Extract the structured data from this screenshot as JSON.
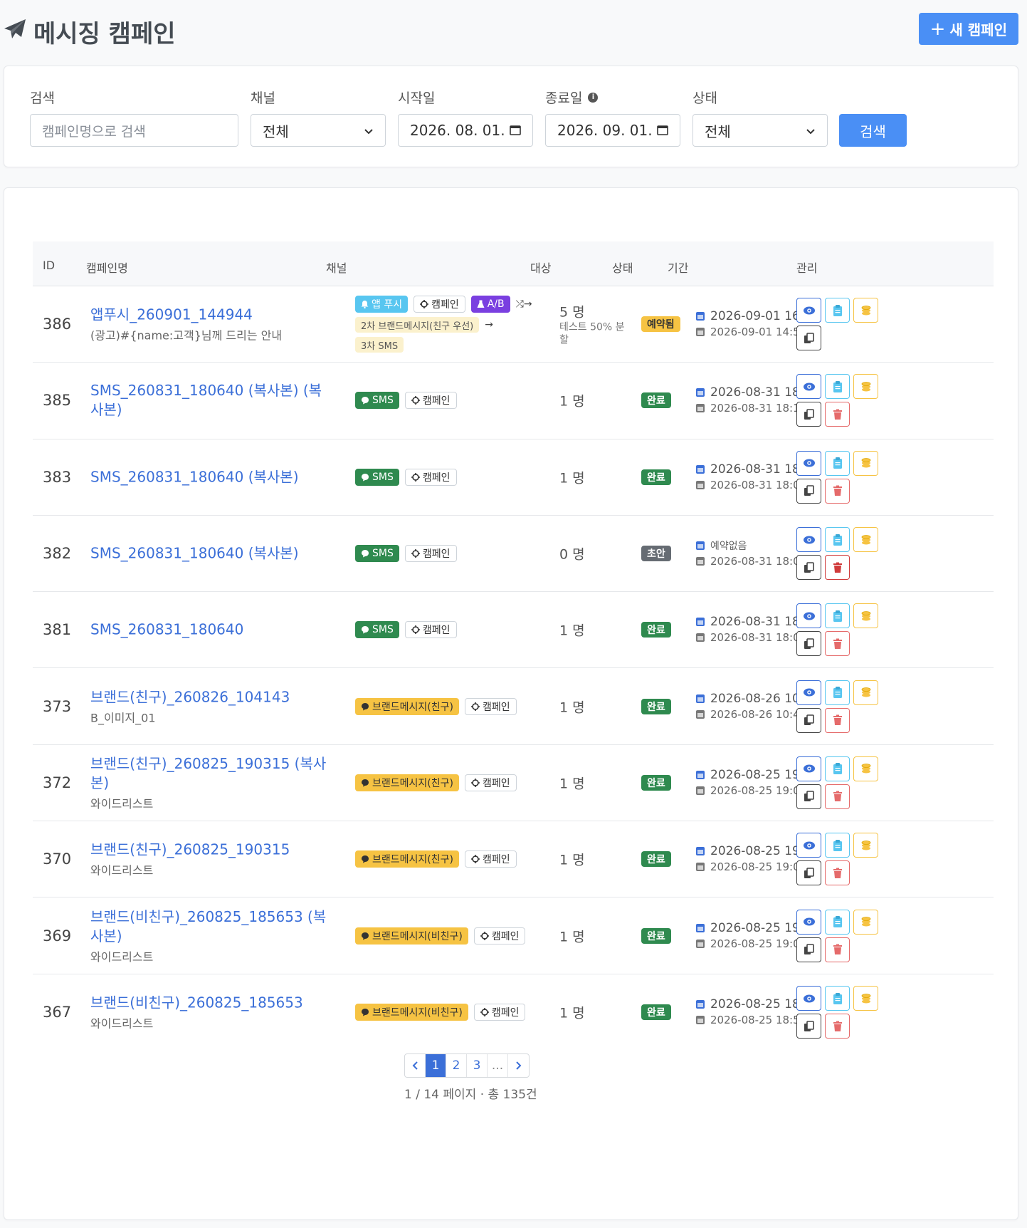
{
  "header": {
    "title": "메시징 캠페인",
    "title_icon": "paper-plane-icon",
    "new_button_label": "새 캠페인",
    "new_button_icon": "plus-icon"
  },
  "filters": {
    "search_label": "검색",
    "search_placeholder": "캠페인명으로 검색",
    "channel_label": "채널",
    "channel_value": "전체",
    "start_label": "시작일",
    "start_value": "2026. 08. 01.",
    "end_label": "종료일",
    "end_value": "2026. 09. 01.",
    "status_label": "상태",
    "status_value": "전체",
    "search_button": "검색"
  },
  "table": {
    "headers": [
      "ID",
      "캠페인명",
      "채널",
      "대상",
      "상태",
      "기간",
      "관리"
    ],
    "rows": [
      {
        "id": "386",
        "name": "앱푸시_260901_144944",
        "sub": "(광고)#{name:고객}님께 드리는 안내",
        "target": "5 명",
        "target_sub": "테스트 50% 분할",
        "status": "예약됨",
        "status_type": "res",
        "date1": "2026-09-01 16:59",
        "date2": "2026-09-01 14:51",
        "delete": false,
        "channel_type": "push"
      },
      {
        "id": "385",
        "name": "SMS_260831_180640 (복사본) (복사본)",
        "sub": "",
        "target": "1 명",
        "target_sub": "",
        "status": "완료",
        "status_type": "done",
        "date1": "2026-08-31 18:17",
        "date2": "2026-08-31 18:17",
        "delete": true,
        "channel_type": "sms"
      },
      {
        "id": "383",
        "name": "SMS_260831_180640 (복사본)",
        "sub": "",
        "target": "1 명",
        "target_sub": "",
        "status": "완료",
        "status_type": "done",
        "date1": "2026-08-31 18:10",
        "date2": "2026-08-31 18:09",
        "delete": true,
        "channel_type": "sms"
      },
      {
        "id": "382",
        "name": "SMS_260831_180640 (복사본)",
        "sub": "",
        "target": "0 명",
        "target_sub": "",
        "status": "초안",
        "status_type": "draft",
        "date1": "예약없음",
        "date2": "2026-08-31 18:08",
        "delete": true,
        "delete_solid": true,
        "channel_type": "sms"
      },
      {
        "id": "381",
        "name": "SMS_260831_180640",
        "sub": "",
        "target": "1 명",
        "target_sub": "",
        "status": "완료",
        "status_type": "done",
        "date1": "2026-08-31 18:07",
        "date2": "2026-08-31 18:07",
        "delete": true,
        "channel_type": "sms"
      },
      {
        "id": "373",
        "name": "브랜드(친구)_260826_104143",
        "sub": "B_이미지_01",
        "target": "1 명",
        "target_sub": "",
        "status": "완료",
        "status_type": "done",
        "date1": "2026-08-26 10:42",
        "date2": "2026-08-26 10:42",
        "delete": true,
        "channel_type": "brand",
        "brand_label": "브랜드메시지(친구)"
      },
      {
        "id": "372",
        "name": "브랜드(친구)_260825_190315 (복사본)",
        "sub": "와이드리스트",
        "target": "1 명",
        "target_sub": "",
        "status": "완료",
        "status_type": "done",
        "date1": "2026-08-25 19:07",
        "date2": "2026-08-25 19:07",
        "delete": true,
        "channel_type": "brand",
        "brand_label": "브랜드메시지(친구)"
      },
      {
        "id": "370",
        "name": "브랜드(친구)_260825_190315",
        "sub": "와이드리스트",
        "target": "1 명",
        "target_sub": "",
        "status": "완료",
        "status_type": "done",
        "date1": "2026-08-25 19:03",
        "date2": "2026-08-25 19:03",
        "delete": true,
        "channel_type": "brand",
        "brand_label": "브랜드메시지(친구)"
      },
      {
        "id": "369",
        "name": "브랜드(비친구)_260825_185653 (복사본)",
        "sub": "와이드리스트",
        "target": "1 명",
        "target_sub": "",
        "status": "완료",
        "status_type": "done",
        "date1": "2026-08-25 19:01",
        "date2": "2026-08-25 19:01",
        "delete": true,
        "channel_type": "brand",
        "brand_label": "브랜드메시지(비친구)"
      },
      {
        "id": "367",
        "name": "브랜드(비친구)_260825_185653",
        "sub": "와이드리스트",
        "target": "1 명",
        "target_sub": "",
        "status": "완료",
        "status_type": "done",
        "date1": "2026-08-25 18:57",
        "date2": "2026-08-25 18:57",
        "delete": true,
        "channel_type": "brand",
        "brand_label": "브랜드메시지(비친구)"
      }
    ]
  },
  "channel_labels": {
    "sms": "SMS",
    "campaign": "캠페인",
    "push": "앱 푸시",
    "ab": "A/B",
    "flow_step2": "2차 브랜드메시지(친구 우선)",
    "flow_step3": "3차 SMS"
  },
  "pagination": {
    "pages": [
      "1",
      "2",
      "3",
      "..."
    ],
    "info": "1 / 14 페이지 · 총 135건"
  },
  "colors": {
    "primary": "#4a8ff5",
    "link": "#3b6fd8",
    "success": "#2f8a4f",
    "warning": "#f6c343",
    "draft": "#666c73"
  }
}
